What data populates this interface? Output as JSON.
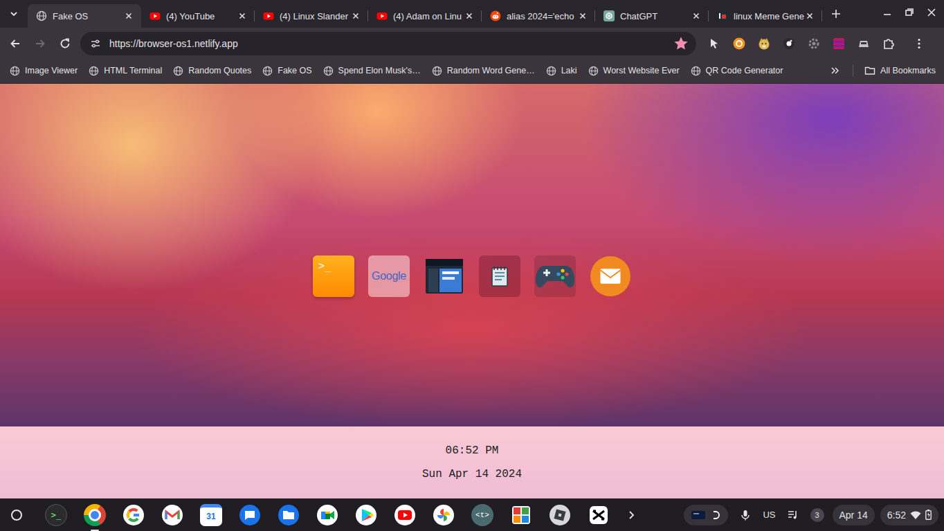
{
  "tab_strip": {
    "tabs": [
      {
        "title": "Fake OS",
        "kind": "globe",
        "selected": true
      },
      {
        "title": "(4) YouTube",
        "kind": "youtube",
        "selected": false
      },
      {
        "title": "(4) Linux Slander",
        "kind": "youtube",
        "selected": false
      },
      {
        "title": "(4) Adam on Linu",
        "kind": "youtube",
        "selected": false
      },
      {
        "title": "alias 2024='echo",
        "kind": "reddit",
        "selected": false
      },
      {
        "title": "ChatGPT",
        "kind": "chatgpt",
        "selected": false
      },
      {
        "title": "linux Meme Gene",
        "kind": "imgflip",
        "selected": false
      }
    ]
  },
  "toolbar": {
    "back_disabled": false,
    "forward_disabled": true,
    "url": "https://browser-os1.netlify.app",
    "bookmarked": true
  },
  "bookmarks_bar": {
    "items": [
      "Image Viewer",
      "HTML Terminal",
      "Random Quotes",
      "Fake OS",
      "Spend Elon Musk's…",
      "Random Word Gene…",
      "Laki",
      "Worst Website Ever",
      "QR Code Generator"
    ],
    "all_bookmarks": "All Bookmarks"
  },
  "page": {
    "desktop_icons": [
      {
        "kind": "terminal",
        "label": ">_"
      },
      {
        "kind": "google",
        "label": "Google"
      },
      {
        "kind": "files"
      },
      {
        "kind": "notes"
      },
      {
        "kind": "games"
      },
      {
        "kind": "mail"
      }
    ],
    "clock": {
      "time": "06:52 PM",
      "date": "Sun Apr 14 2024"
    }
  },
  "shelf": {
    "apps": [
      {
        "kind": "terminal",
        "label": ">_",
        "running": false
      },
      {
        "kind": "chrome",
        "running": true
      },
      {
        "kind": "google",
        "running": false
      },
      {
        "kind": "gmail",
        "running": false
      },
      {
        "kind": "calendar",
        "label": "31",
        "running": false
      },
      {
        "kind": "messages",
        "running": false
      },
      {
        "kind": "files",
        "running": false
      },
      {
        "kind": "meet",
        "running": false
      },
      {
        "kind": "play",
        "running": false
      },
      {
        "kind": "youtube",
        "running": false
      },
      {
        "kind": "photos",
        "running": false
      },
      {
        "kind": "text",
        "label": "<t>",
        "running": false
      },
      {
        "kind": "blocks",
        "running": false
      },
      {
        "kind": "roblox",
        "running": false
      },
      {
        "kind": "capcut",
        "running": false
      }
    ],
    "tray": {
      "ime": "US",
      "notifications": "3",
      "date": "Apr 14",
      "time": "6:52"
    }
  }
}
